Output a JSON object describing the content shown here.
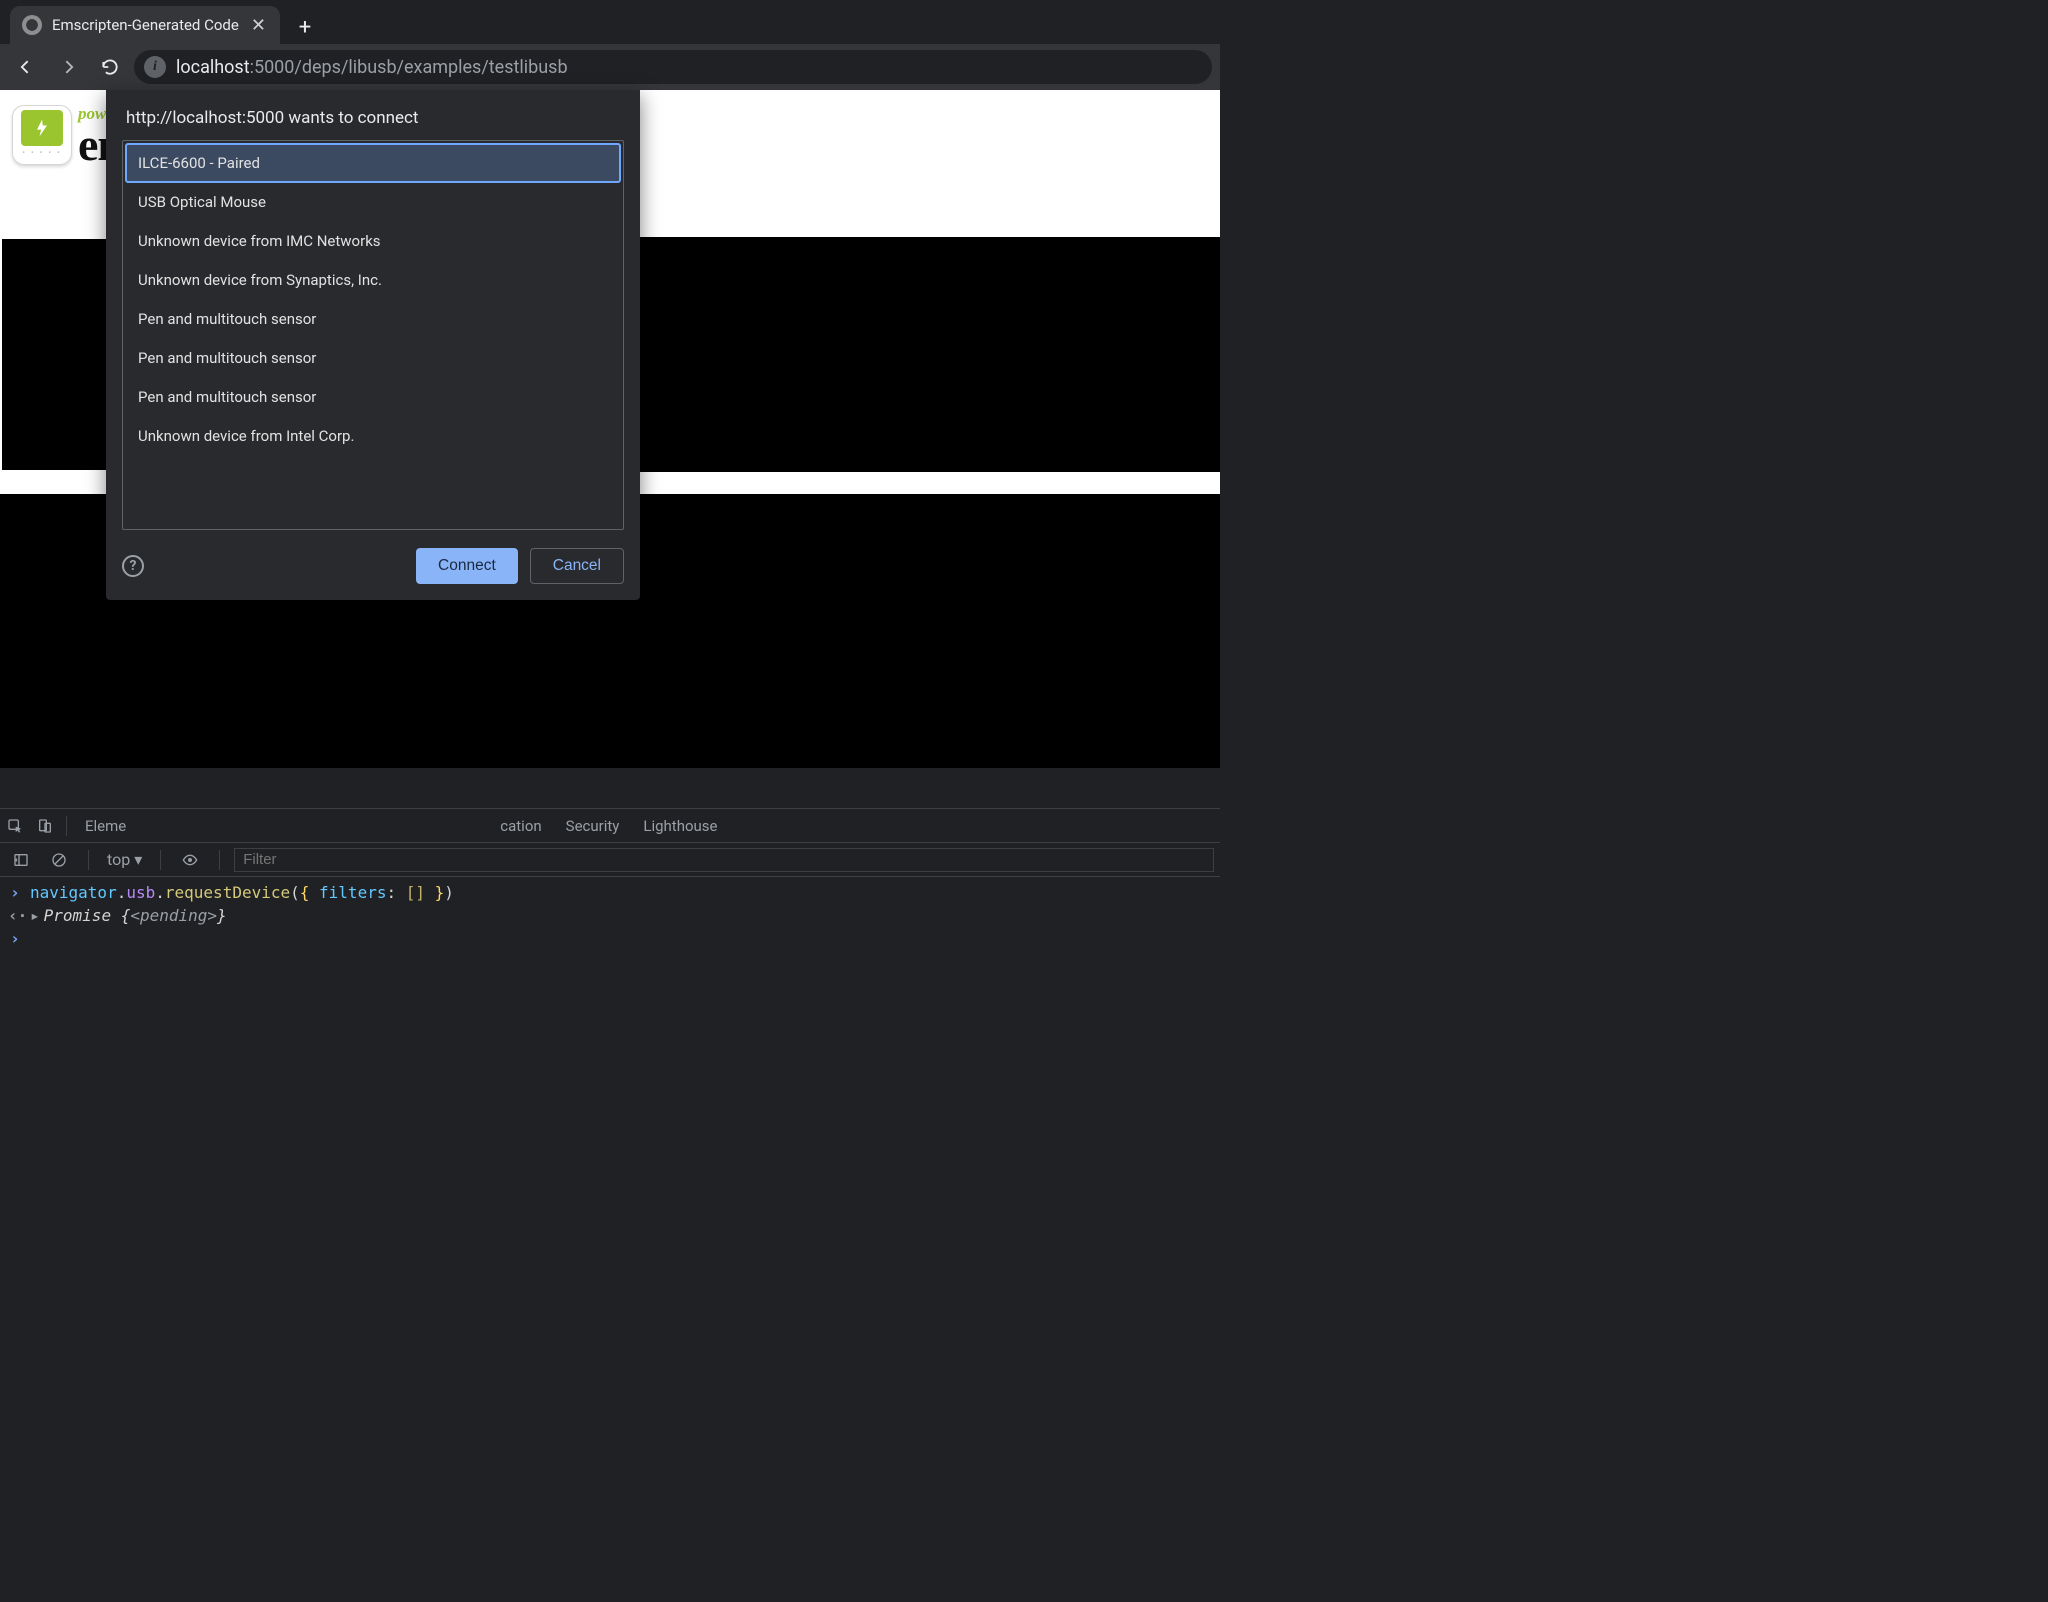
{
  "tab": {
    "title": "Emscripten-Generated Code"
  },
  "url": {
    "host": "localhost",
    "port_path": ":5000/deps/libusb/examples/testlibusb"
  },
  "page": {
    "powered": "pow",
    "en": "en"
  },
  "dialog": {
    "title": "http://localhost:5000 wants to connect",
    "devices": [
      "ILCE-6600 - Paired",
      "USB Optical Mouse",
      "Unknown device from IMC Networks",
      "Unknown device from Synaptics, Inc.",
      "Pen and multitouch sensor",
      "Pen and multitouch sensor",
      "Pen and multitouch sensor",
      "Unknown device from Intel Corp."
    ],
    "connect": "Connect",
    "cancel": "Cancel"
  },
  "devtools": {
    "tabs": {
      "elements": "Eleme",
      "console_hidden": "",
      "sources_tail": "",
      "network_tail": "",
      "memory_tail": "",
      "application_tail": "cation",
      "security": "Security",
      "lighthouse": "Lighthouse"
    },
    "context": "top",
    "filter_placeholder": "Filter",
    "console": {
      "input": {
        "p1": "navigator",
        "p2": ".",
        "p3": "usb",
        "p4": ".",
        "p5": "requestDevice",
        "p6": "(",
        "p7": "{ ",
        "p8": "filters",
        "p9": ": ",
        "p10": "[] ",
        "p11": "}",
        "p12": ")"
      },
      "output": {
        "p1": "Promise ",
        "p2": "{",
        "p3": "<pending>",
        "p4": "}"
      }
    }
  }
}
